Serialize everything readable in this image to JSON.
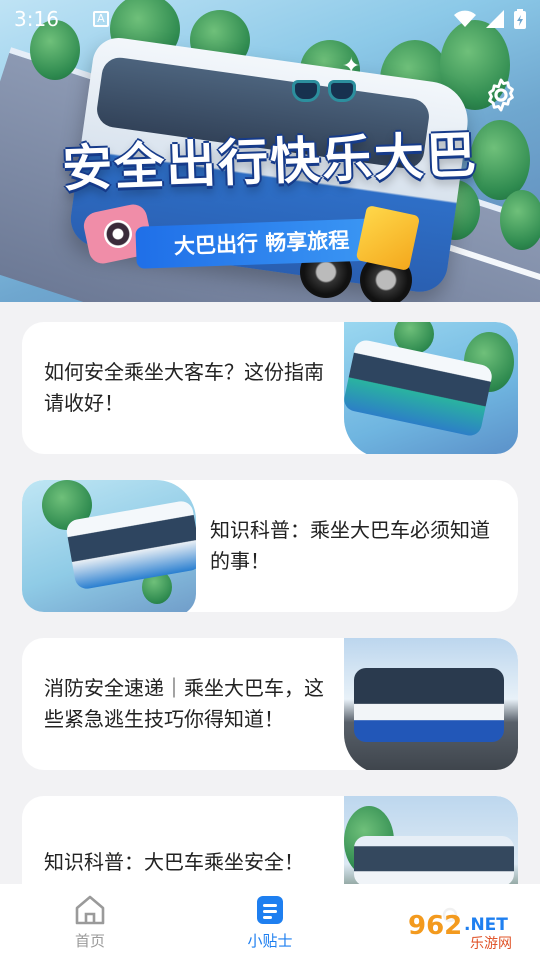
{
  "status_bar": {
    "time": "3:16",
    "notification_icon": "a-icon",
    "icons": [
      "wifi-icon",
      "signal-icon",
      "battery-icon"
    ]
  },
  "hero": {
    "title": "安全出行快乐大巴",
    "subtitle": "大巴出行 畅享旅程",
    "settings_icon": "gear-icon"
  },
  "articles": [
    {
      "title": "如何安全乘坐大客车？这份指南请收好！",
      "image_side": "right"
    },
    {
      "title": "知识科普：乘坐大巴车必须知道的事！",
      "image_side": "left"
    },
    {
      "title": "消防安全速递｜乘坐大巴车，这些紧急逃生技巧你得知道！",
      "image_side": "right"
    },
    {
      "title": "知识科普：大巴车乘坐安全！",
      "image_side": "right"
    }
  ],
  "bottom_nav": {
    "items": [
      {
        "label": "首页",
        "icon": "home-icon",
        "active": false
      },
      {
        "label": "小贴士",
        "icon": "document-icon",
        "active": true
      }
    ],
    "active_color": "#1e7ff0",
    "inactive_color": "#9a9a9a"
  },
  "watermark": {
    "brand": "962.NET",
    "subtext": "乐游网"
  }
}
